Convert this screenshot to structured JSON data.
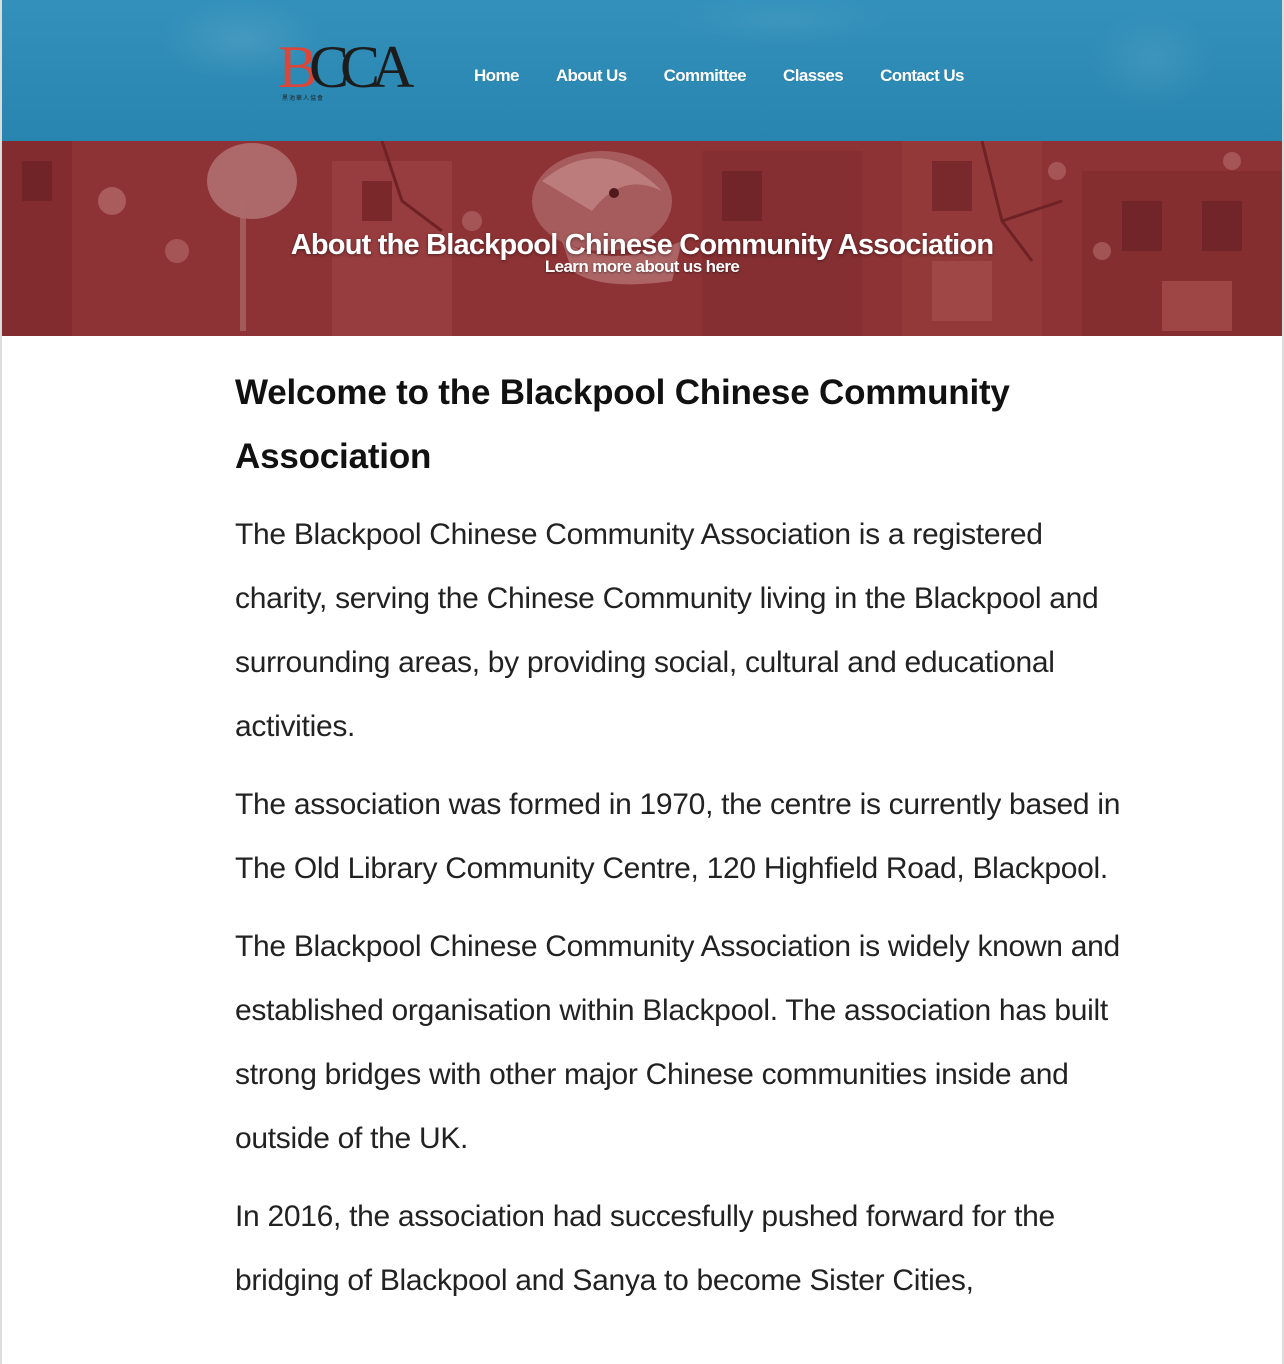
{
  "logo": {
    "letter_b": "B",
    "letters_rest": "CCA",
    "subtitle": "黑池華人協會"
  },
  "nav": {
    "items": [
      {
        "label": "Home"
      },
      {
        "label": "About Us"
      },
      {
        "label": "Committee"
      },
      {
        "label": "Classes"
      },
      {
        "label": "Contact Us"
      }
    ]
  },
  "hero": {
    "title": "About the Blackpool Chinese Community Association",
    "subtitle": "Learn more about us here"
  },
  "content": {
    "heading": "Welcome to the Blackpool Chinese Community Association",
    "paragraphs": [
      "The Blackpool Chinese Community Association is a registered charity, serving the Chinese Community living in the Blackpool and surrounding areas, by providing social, cultural and educational activities.",
      "The association was formed in 1970, the centre is currently based in The Old Library Community Centre, 120 Highfield Road, Blackpool.",
      "The Blackpool Chinese Community Association is widely known and established organisation within Blackpool. The association has built strong bridges with other major Chinese communities inside and outside of the UK.",
      "In 2016, the association had succesfully pushed forward for the bridging of Blackpool and Sanya to become Sister Cities,"
    ]
  },
  "colors": {
    "header_blue": "#2a8cb8",
    "hero_red": "#8a3436",
    "logo_red": "#d9473a",
    "text_dark": "#222222"
  }
}
